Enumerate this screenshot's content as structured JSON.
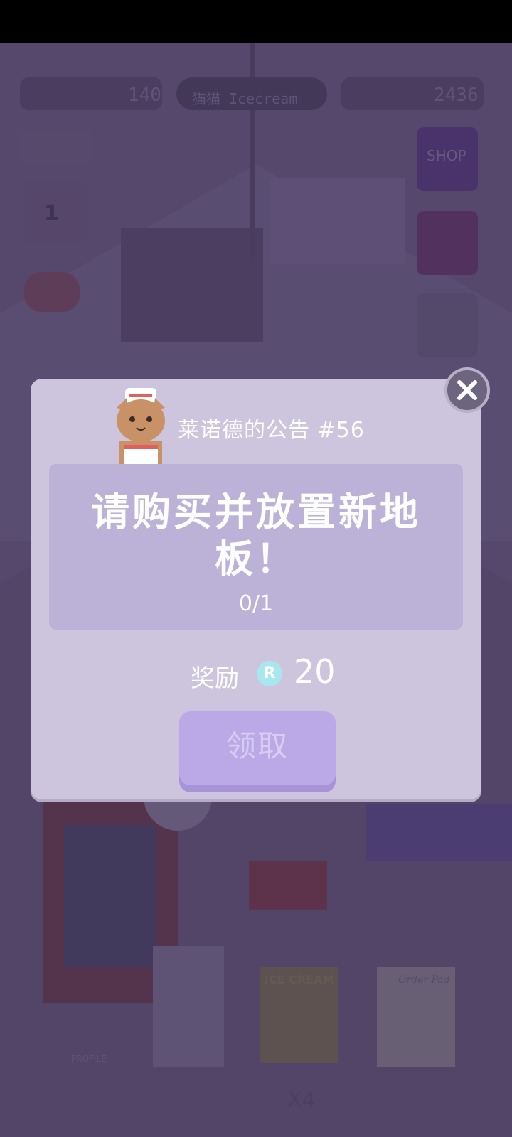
{
  "hud": {
    "hearts": "140",
    "shop_sign": "猫猫 Icecream",
    "coins": "2436",
    "shop_button_label": "SHOP",
    "calendar_day": "1"
  },
  "scene": {
    "poster_text": "ICE CREAM",
    "paper_text": "Order Pad",
    "book_text": "PROFILE",
    "multiplier": "X4"
  },
  "dialog": {
    "title": "莱诺德的公告 #56",
    "task_line1": "请购买并放置新地",
    "task_line2": "板！",
    "progress": "0/1",
    "reward_label": "奖励",
    "reward_icon_letter": "R",
    "reward_value": "20",
    "claim_label": "领取"
  },
  "colors": {
    "dialog_bg": "#cdc5dd",
    "task_box_bg": "#bcb1d6",
    "claim_button": "#bba8e6",
    "close_button": "#6d6480"
  }
}
